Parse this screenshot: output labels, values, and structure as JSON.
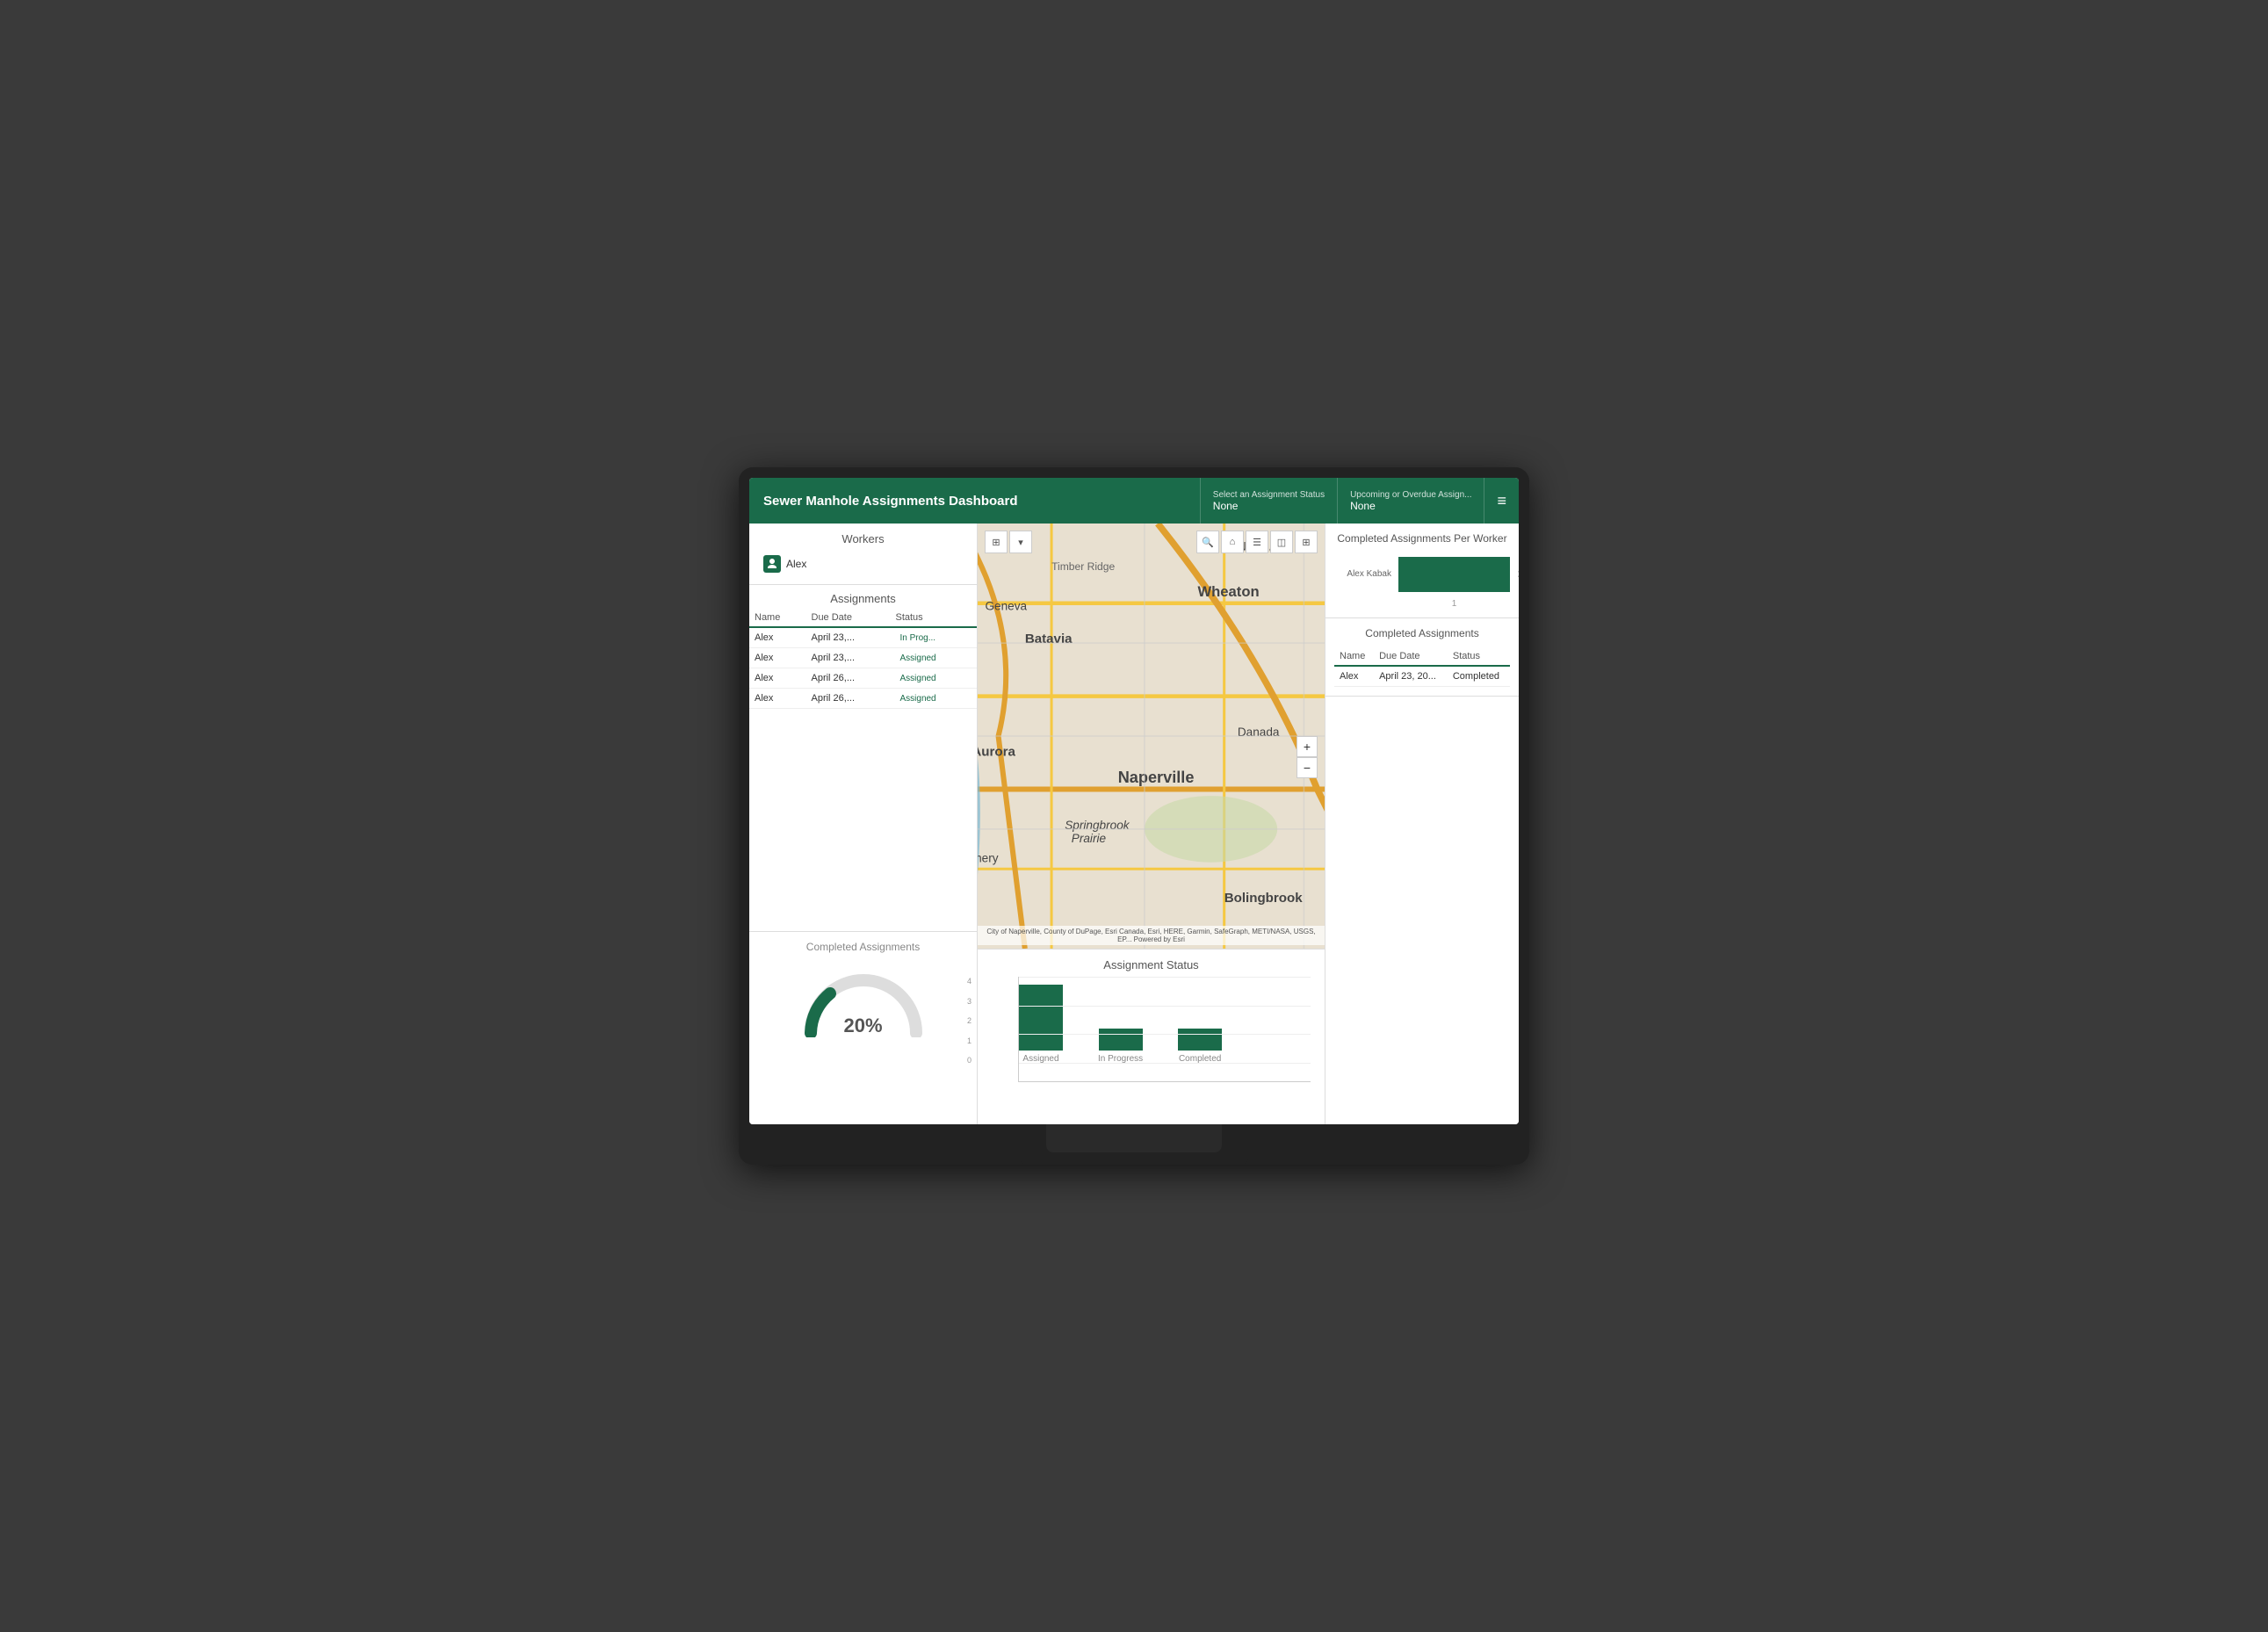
{
  "header": {
    "title": "Sewer Manhole Assignments Dashboard",
    "filter1_label": "Select an Assignment Status",
    "filter1_value": "None",
    "filter2_label": "Upcoming or Overdue Assign...",
    "filter2_value": "None",
    "menu_icon": "≡"
  },
  "workers": {
    "section_title": "Workers",
    "items": [
      {
        "name": "Alex",
        "icon": "🔑"
      }
    ]
  },
  "assignments": {
    "section_title": "Assignments",
    "columns": [
      "Name",
      "Due Date",
      "Status"
    ],
    "rows": [
      {
        "name": "Alex",
        "due_date": "April 23,...",
        "status": "In Prog..."
      },
      {
        "name": "Alex",
        "due_date": "April 23,...",
        "status": "Assigned"
      },
      {
        "name": "Alex",
        "due_date": "April 26,...",
        "status": "Assigned"
      },
      {
        "name": "Alex",
        "due_date": "April 26,...",
        "status": "Assigned"
      }
    ]
  },
  "completed_assignments_gauge": {
    "title": "Completed Assignments",
    "percent": "20%",
    "percent_num": 20
  },
  "map": {
    "attribution": "City of Naperville, County of DuPage, Esri Canada, Esri, HERE, Garmin, SafeGraph, METI/NASA, USGS, EP...   Powered by Esri"
  },
  "assignment_status_chart": {
    "title": "Assignment Status",
    "bars": [
      {
        "label": "Assigned",
        "value": 3,
        "max": 4
      },
      {
        "label": "In Progress",
        "value": 1,
        "max": 4
      },
      {
        "label": "Completed",
        "value": 1,
        "max": 4
      }
    ],
    "y_labels": [
      "0",
      "1",
      "2",
      "3",
      "4"
    ]
  },
  "completed_per_worker": {
    "title": "Completed Assignments Per Worker",
    "bars": [
      {
        "name": "Alex Kabak",
        "value": 1,
        "max": 1
      }
    ],
    "x_label": "1"
  },
  "completed_table": {
    "title": "Completed Assignments",
    "columns": [
      "Name",
      "Due Date",
      "Status"
    ],
    "rows": [
      {
        "name": "Alex",
        "due_date": "April 23, 20...",
        "status": "Completed"
      }
    ]
  }
}
